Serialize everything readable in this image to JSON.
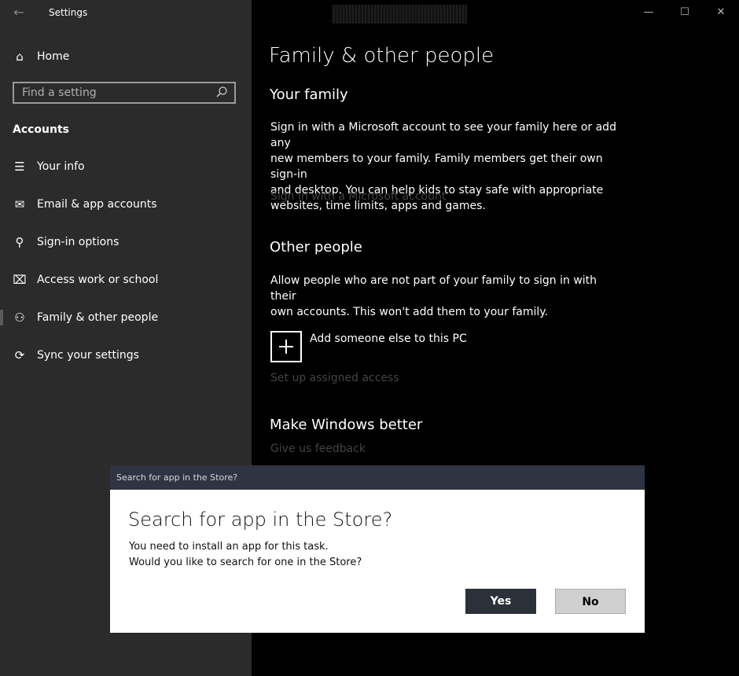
{
  "window": {
    "title": "Settings",
    "back_glyph": "←",
    "minimize_glyph": "—",
    "maximize_glyph": "☐",
    "close_glyph": "✕"
  },
  "sidebar": {
    "home": {
      "label": "Home",
      "icon": "home-icon",
      "glyph": "⌂"
    },
    "search": {
      "placeholder": "Find a setting",
      "value": ""
    },
    "section_title": "Accounts",
    "items": [
      {
        "label": "Your info",
        "icon": "person-card-icon",
        "glyph": "☰"
      },
      {
        "label": "Email & app accounts",
        "icon": "mail-icon",
        "glyph": "✉"
      },
      {
        "label": "Sign-in options",
        "icon": "key-icon",
        "glyph": "⚲"
      },
      {
        "label": "Access work or school",
        "icon": "briefcase-icon",
        "glyph": "⌧"
      },
      {
        "label": "Family & other people",
        "icon": "person-add-icon",
        "glyph": "⚇",
        "active": true
      },
      {
        "label": "Sync your settings",
        "icon": "sync-icon",
        "glyph": "⟳"
      }
    ]
  },
  "main": {
    "page_title": "Family & other people",
    "your_family": {
      "title": "Your family",
      "lines": [
        "Sign in with a Microsoft account to see your family here or add any",
        "new members to your family. Family members get their own sign-in",
        "and desktop. You can help kids to stay safe with appropriate",
        "websites, time limits, apps and games."
      ],
      "link": "Sign in with a Microsoft account"
    },
    "other_people": {
      "title": "Other people",
      "lines": [
        "Allow people who are not part of your family to sign in with their",
        "own accounts. This won't add them to your family."
      ],
      "add_label": "Add someone else to this PC",
      "link": "Set up assigned access"
    },
    "make_better": {
      "title": "Make Windows better",
      "link": "Give us feedback"
    }
  },
  "dialog": {
    "titlebar": "Search for app in the Store?",
    "heading": "Search for app in the Store?",
    "lines": [
      "You need to install an app for this task.",
      "Would you like to search for one in the Store?"
    ],
    "yes_label": "Yes",
    "no_label": "No"
  }
}
